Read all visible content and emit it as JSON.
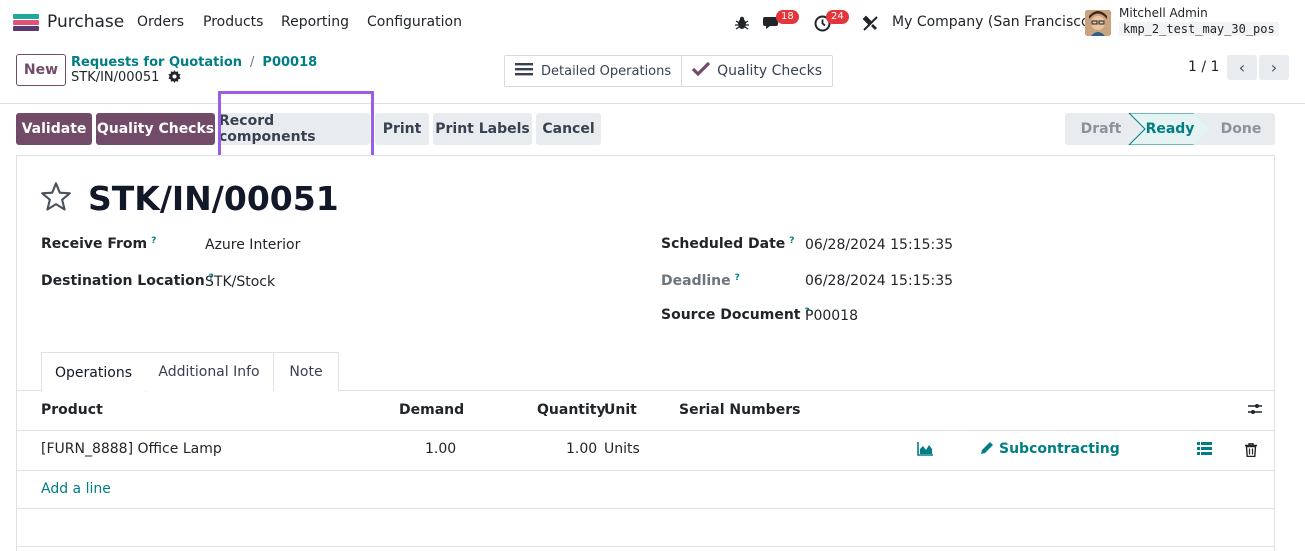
{
  "navbar": {
    "app_name": "Purchase",
    "menu": [
      "Orders",
      "Products",
      "Reporting",
      "Configuration"
    ],
    "chat_count": "18",
    "activity_count": "24",
    "company": "My Company (San Francisco)",
    "user_name": "Mitchell Admin",
    "db_name": "kmp_2_test_may_30_pos"
  },
  "control": {
    "new_label": "New",
    "breadcrumb": [
      "Requests for Quotation",
      "P00018"
    ],
    "record_name": "STK/IN/00051",
    "smart_buttons": [
      "Detailed Operations",
      "Quality Checks"
    ],
    "pager": "1 / 1"
  },
  "actions": {
    "validate": "Validate",
    "quality_checks": "Quality Checks",
    "record_components": "Record components",
    "print": "Print",
    "print_labels": "Print Labels",
    "cancel": "Cancel"
  },
  "status": {
    "steps": [
      "Draft",
      "Ready",
      "Done"
    ],
    "active": "Ready"
  },
  "form": {
    "title": "STK/IN/00051",
    "receive_from_label": "Receive From",
    "receive_from": "Azure Interior",
    "destination_label": "Destination Location",
    "destination": "STK/Stock",
    "scheduled_label": "Scheduled Date",
    "scheduled": "06/28/2024 15:15:35",
    "deadline_label": "Deadline",
    "deadline": "06/28/2024 15:15:35",
    "source_label": "Source Document",
    "source": "P00018",
    "help_mark": "?"
  },
  "tabs": [
    "Operations",
    "Additional Info",
    "Note"
  ],
  "table": {
    "headers": [
      "Product",
      "Demand",
      "Quantity",
      "Unit",
      "Serial Numbers"
    ],
    "rows": [
      {
        "product": "[FURN_8888] Office Lamp",
        "demand": "1.00",
        "quantity": "1.00",
        "unit": "Units",
        "route": "Subcontracting"
      }
    ],
    "add_line": "Add a line"
  },
  "colors": {
    "primary": "#714b67",
    "accent": "#017e84",
    "highlight": "#9b5de5"
  }
}
